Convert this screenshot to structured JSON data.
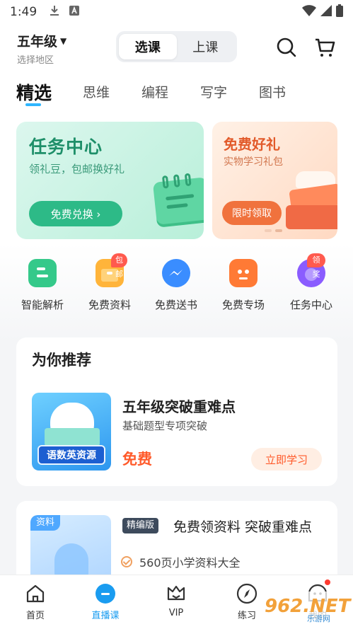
{
  "status_bar": {
    "time": "1:49",
    "icons": [
      "download-icon",
      "a-icon",
      "wifi-icon",
      "signal-icon",
      "battery-icon"
    ]
  },
  "header": {
    "grade": "五年级",
    "region": "选择地区",
    "segment": {
      "options": [
        "选课",
        "上课"
      ],
      "selected": "选课"
    },
    "icons": [
      "search-icon",
      "cart-icon"
    ]
  },
  "tabs": [
    {
      "label": "精选",
      "active": true
    },
    {
      "label": "思维",
      "active": false
    },
    {
      "label": "编程",
      "active": false
    },
    {
      "label": "写字",
      "active": false
    },
    {
      "label": "图书",
      "active": false
    }
  ],
  "banners": {
    "left": {
      "title": "任务中心",
      "subtitle": "领礼豆，包邮换好礼",
      "button": "免费兑换 ›"
    },
    "right": {
      "title": "免费好礼",
      "subtitle": "实物学习礼包",
      "button": "限时领取"
    }
  },
  "quick_icons": [
    {
      "label": "智能解析",
      "badge": "",
      "color": "#35c98a"
    },
    {
      "label": "免费资料",
      "badge": "包邮",
      "color": "#ffb43a"
    },
    {
      "label": "免费送书",
      "badge": "",
      "color": "#3a8dff"
    },
    {
      "label": "免费专场",
      "badge": "",
      "color": "#ff7a35"
    },
    {
      "label": "任务中心",
      "badge": "领奖",
      "color": "#8a5cff"
    }
  ],
  "recommend": {
    "heading": "为你推荐",
    "thumb_label": "语数英资源",
    "title": "五年级突破重难点",
    "subtitle": "基础题型专项突破",
    "price": "免费",
    "button": "立即学习"
  },
  "promo": {
    "thumb_tag": "资料",
    "edition": "精编版",
    "title": "免费领资料 突破重难点",
    "feature": "560页小学资料大全"
  },
  "bottom_nav": [
    {
      "label": "首页",
      "active": false
    },
    {
      "label": "直播课",
      "active": true
    },
    {
      "label": "VIP",
      "active": false
    },
    {
      "label": "练习",
      "active": false
    },
    {
      "label": "我的",
      "active": false
    }
  ],
  "watermark": {
    "text": "962.NET",
    "sub": "乐游网"
  },
  "colors": {
    "accent": "#1a9cf0",
    "green": "#2dba87",
    "orange": "#f0723d",
    "price": "#ff5a2a"
  }
}
